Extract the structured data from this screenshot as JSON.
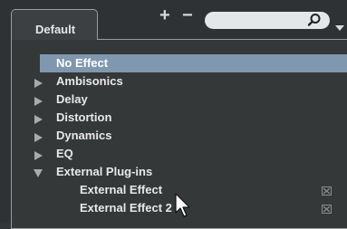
{
  "tab": {
    "label": "Default"
  },
  "toolbar": {
    "add_symbol": "+",
    "remove_symbol": "−"
  },
  "search": {
    "value": "",
    "placeholder": ""
  },
  "list": {
    "items": [
      {
        "label": "No Effect",
        "type": "item",
        "selected": true
      },
      {
        "label": "Ambisonics",
        "type": "folder",
        "expanded": false
      },
      {
        "label": "Delay",
        "type": "folder",
        "expanded": false
      },
      {
        "label": "Distortion",
        "type": "folder",
        "expanded": false
      },
      {
        "label": "Dynamics",
        "type": "folder",
        "expanded": false
      },
      {
        "label": "EQ",
        "type": "folder",
        "expanded": false
      },
      {
        "label": "External Plug-ins",
        "type": "folder",
        "expanded": true
      },
      {
        "label": "External Effect",
        "type": "child",
        "icon": "external-plugin-icon"
      },
      {
        "label": "External Effect 2",
        "type": "child",
        "icon": "external-plugin-icon"
      }
    ]
  },
  "colors": {
    "background": "#2f3234",
    "panel": "#353839",
    "selection": "#7f98b0",
    "text": "#e8e8e8",
    "search_bg": "#e4e6e8"
  }
}
